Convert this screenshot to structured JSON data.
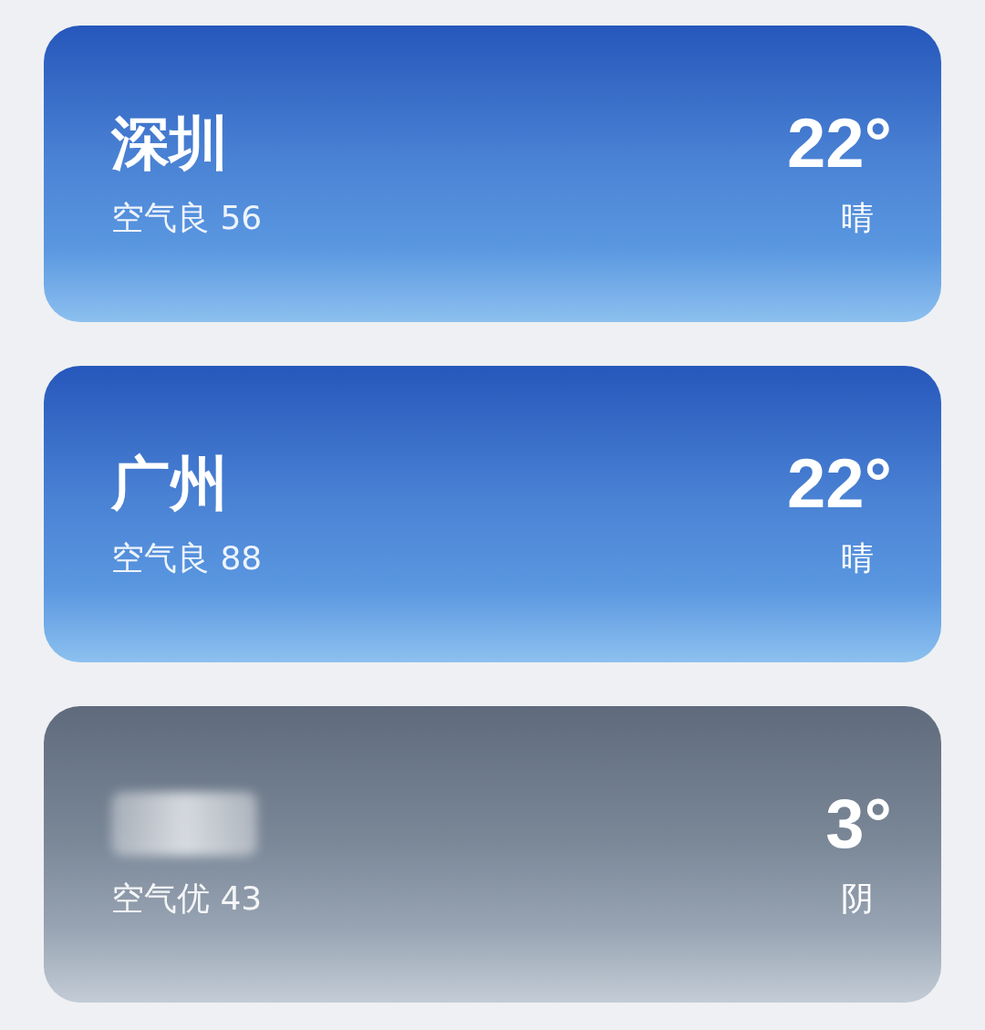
{
  "cities": [
    {
      "name": "深圳",
      "blurred": false,
      "air": "空气良 56",
      "temp": "22°",
      "condition": "晴",
      "kind": "sunny"
    },
    {
      "name": "广州",
      "blurred": false,
      "air": "空气良 88",
      "temp": "22°",
      "condition": "晴",
      "kind": "sunny"
    },
    {
      "blurred": true,
      "air": "空气优 43",
      "temp": "3°",
      "condition": "阴",
      "kind": "cloudy"
    }
  ]
}
